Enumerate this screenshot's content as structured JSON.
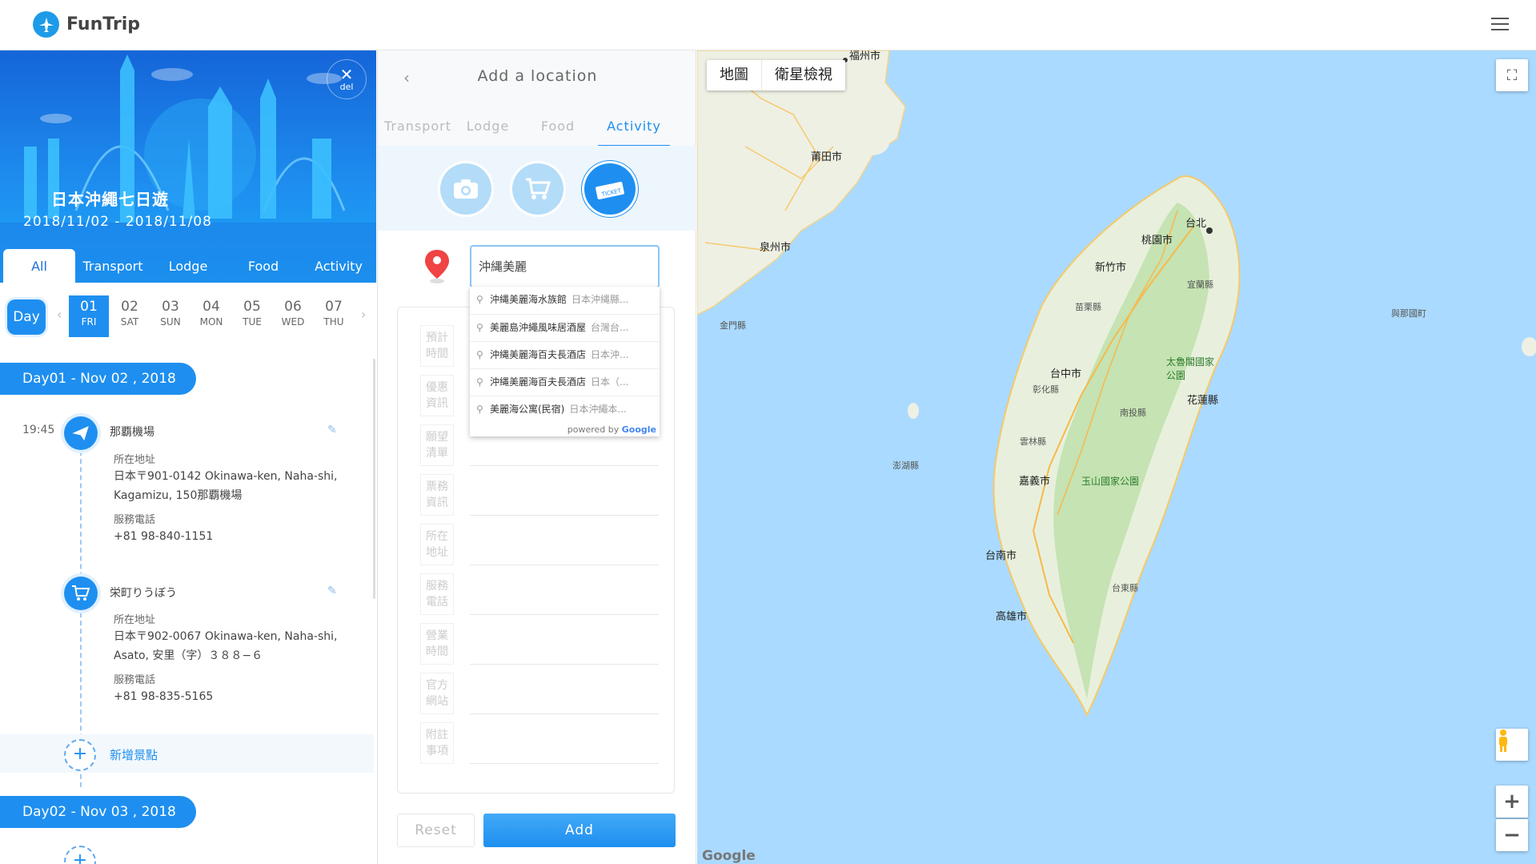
{
  "app": {
    "name": "FunTrip"
  },
  "trip": {
    "title": "日本沖繩七日遊",
    "dates": "2018/11/02 - 2018/11/08",
    "delete_label": "del",
    "filters": [
      "All",
      "Transport",
      "Lodge",
      "Food",
      "Activity"
    ],
    "day_button": "Day",
    "days": [
      {
        "num": "01",
        "wd": "FRI"
      },
      {
        "num": "02",
        "wd": "SAT"
      },
      {
        "num": "03",
        "wd": "SUN"
      },
      {
        "num": "04",
        "wd": "MON"
      },
      {
        "num": "05",
        "wd": "TUE"
      },
      {
        "num": "06",
        "wd": "WED"
      },
      {
        "num": "07",
        "wd": "THU"
      }
    ],
    "day1_label": "Day01 - Nov 02 , 2018",
    "day2_label": "Day02 - Nov 03 , 2018",
    "add_spot_label": "新增景點",
    "items": [
      {
        "time": "19:45",
        "name": "那覇機場",
        "address_label": "所在地址",
        "address": "日本〒901-0142 Okinawa-ken, Naha-shi, Kagamizu, 150那覇機場",
        "phone_label": "服務電話",
        "phone": "+81 98-840-1151"
      },
      {
        "time": "",
        "name": "栄町りうぼう",
        "address_label": "所在地址",
        "address": "日本〒902-0067 Okinawa-ken, Naha-shi, Asato, 安里（字）３８８−６",
        "phone_label": "服務電話",
        "phone": "+81 98-835-5165"
      }
    ]
  },
  "add_location": {
    "title": "Add a location",
    "tabs": [
      "Transport",
      "Lodge",
      "Food",
      "Activity"
    ],
    "active_tab": "Activity",
    "search_value": "沖縄美麗",
    "suggestions": [
      {
        "main": "沖縄美麗海水族館",
        "sub": "日本沖縄縣..."
      },
      {
        "main": "美麗島沖繩風味居酒屋",
        "sub": "台灣台..."
      },
      {
        "main": "沖縄美麗海百夫長酒店",
        "sub": "日本沖..."
      },
      {
        "main": "沖縄美麗海百夫長酒店",
        "sub": "日本（..."
      },
      {
        "main": "美麗海公寓(民宿)",
        "sub": "日本沖繩本..."
      }
    ],
    "powered_by": "powered by",
    "powered_brand": "Google",
    "fields": [
      "預計時間",
      "優惠資訊",
      "願望清單",
      "票務資訊",
      "所在地址",
      "服務電話",
      "營業時間",
      "官方網站",
      "附註事項"
    ],
    "reset_label": "Reset",
    "add_label": "Add"
  },
  "map": {
    "type_map": "地圖",
    "type_satellite": "衛星檢視",
    "zoom_in": "+",
    "zoom_out": "−",
    "brand": "Google",
    "labels": [
      "福州市",
      "莆田市",
      "泉州市",
      "金門縣",
      "台北",
      "桃園市",
      "新竹市",
      "苗栗縣",
      "宜蘭縣",
      "台中市",
      "彰化縣",
      "太魯閣國家公園",
      "花蓮縣",
      "南投縣",
      "雲林縣",
      "澎湖縣",
      "嘉義市",
      "玉山國家公園",
      "台南市",
      "台東縣",
      "高雄市",
      "與那國町"
    ]
  },
  "colors": {
    "brand_blue": "#1e8ff0",
    "map_water": "#aadaff",
    "map_land": "#e8f0dd",
    "map_green": "#c5e3b3"
  }
}
